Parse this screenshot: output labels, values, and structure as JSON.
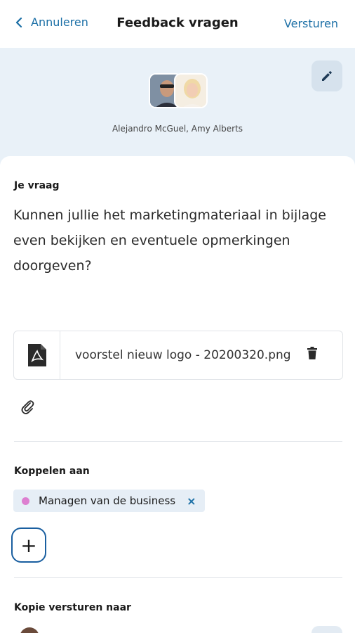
{
  "header": {
    "cancel_label": "Annuleren",
    "title": "Feedback vragen",
    "send_label": "Versturen"
  },
  "recipients": {
    "names": "Alejandro McGuel, Amy Alberts"
  },
  "question": {
    "label": "Je vraag",
    "text": "Kunnen jullie het marketingmateriaal in bijlage even bekijken en eventuele opmerkingen doorgeven?"
  },
  "attachment": {
    "filename": "voorstel nieuw logo - 20200320.png",
    "file_icon": "pdf-file-icon",
    "delete_icon": "trash-icon"
  },
  "link": {
    "label": "Koppelen aan",
    "chip_label": "Managen van de business",
    "chip_dot_color": "#dd7fd0",
    "remove_symbol": "×",
    "add_symbol": "+"
  },
  "copy": {
    "label": "Kopie versturen naar"
  },
  "colors": {
    "accent": "#1b6fa6",
    "hero_bg": "#e9f1f8"
  }
}
